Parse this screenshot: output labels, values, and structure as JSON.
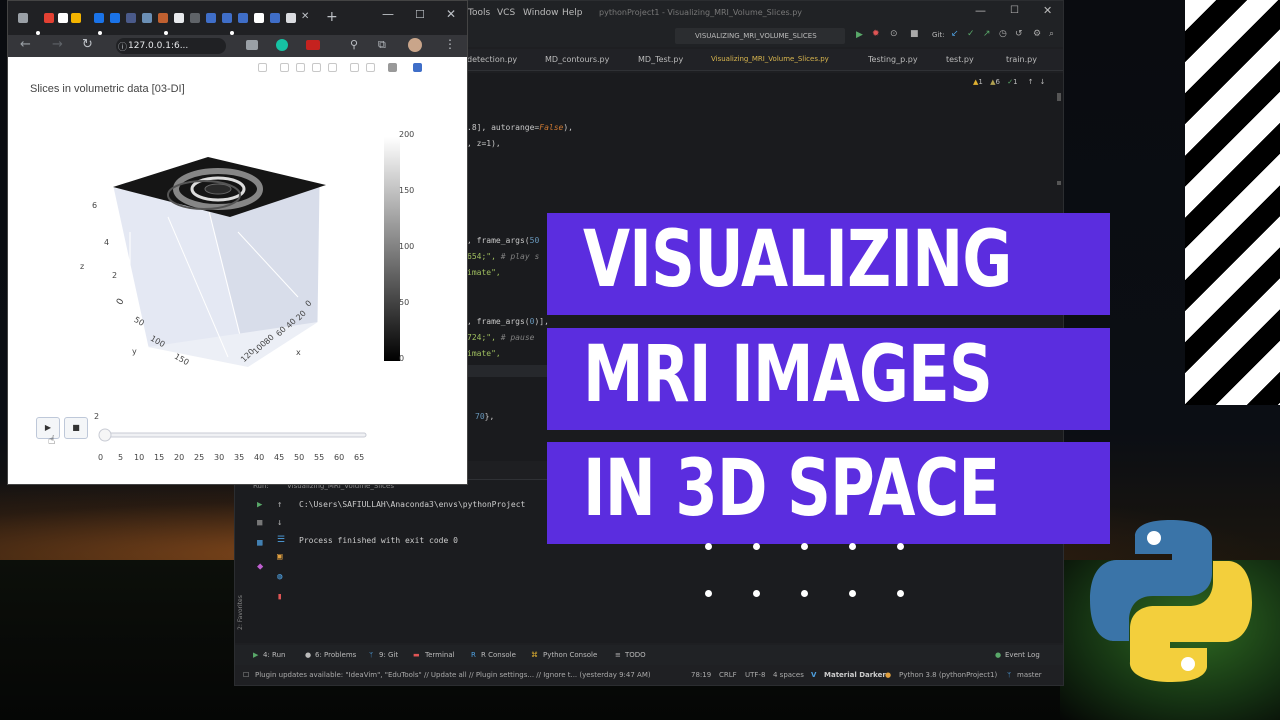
{
  "colors": {
    "banner": "#5b2ddf",
    "headline_text": "#ffffff",
    "ide_bg": "#1e1f22",
    "python_blue": "#3a74a8",
    "python_yellow": "#f3cf3c"
  },
  "headline": {
    "line1": "VISUALIZING",
    "line2": "MRI IMAGES",
    "line3": "IN 3D SPACE"
  },
  "ide": {
    "menu": {
      "tools": "Tools",
      "vcs": "VCS",
      "window": "Window",
      "help": "Help",
      "project_title": "pythonProject1 - Visualizing_MRI_Volume_Slices.py"
    },
    "run_config": "VISUALIZING_MRI_VOLUME_SLICES",
    "git_label": "Git:",
    "tabs": [
      "detection.py",
      "MD_contours.py",
      "MD_Test.py",
      "Visualizing_MRI_Volume_Slices.py",
      "Testing_p.py",
      "test.py",
      "train.py"
    ],
    "inspections": {
      "warnings": "1",
      "weak": "6",
      "typos": "1"
    },
    "code_lines": {
      "l1_a": ".8], autorange=",
      "l1_kw": "False",
      "l1_b": "),",
      "l2": ", z=1),",
      "l3_a": ", frame_args(",
      "l3_num": "50",
      "l4_a": "654;\",",
      "l4_cm": "# play s",
      "l5": "imate\",",
      "l6_a": ", frame_args(",
      "l6_num": "0",
      "l6_b": ")],",
      "l7_a": "724;\",",
      "l7_cm": "# pause",
      "l8": "imate\",",
      "l9_num": "70",
      "l9_b": "},"
    },
    "run_tab": "Run:",
    "run_tab_name": "Visualizing_MRI_Volume_Slices",
    "run_cmd": "C:\\Users\\SAFIULLAH\\Anaconda3\\envs\\pythonProject",
    "run_exit": "Process finished with exit code 0",
    "favorites": "2: Favorites",
    "bottom_tabs": {
      "run": "4: Run",
      "problems": "6: Problems",
      "git": "9: Git",
      "terminal": "Terminal",
      "rconsole": "R Console",
      "pyconsole": "Python Console",
      "todo": "TODO",
      "eventlog": "Event Log"
    },
    "status": {
      "message": "Plugin updates available: \"IdeaVim\", \"EduTools\" // Update all // Plugin settings... // Ignore t... (yesterday 9:47 AM)",
      "position": "78:19",
      "line_sep": "CRLF",
      "encoding": "UTF-8",
      "indent": "4 spaces",
      "theme": "Material Darker",
      "interpreter": "Python 3.8 (pythonProject1)",
      "branch": "master"
    }
  },
  "browser": {
    "url": "127.0.0.1:6...",
    "plot_title": "Slices in volumetric data [03-DI]",
    "colorbar_ticks": [
      "200",
      "150",
      "100",
      "50",
      "0"
    ],
    "z_ticks": [
      "6",
      "4",
      "2",
      "0"
    ],
    "z_label": "z",
    "y_ticks": [
      "0",
      "50",
      "100",
      "150"
    ],
    "y_label": "y",
    "x_ticks": [
      "0",
      "20",
      "40",
      "60",
      "80",
      "100",
      "120"
    ],
    "x_label": "x",
    "slider_current": "2",
    "slider_ticks": [
      "0",
      "5",
      "10",
      "15",
      "20",
      "25",
      "30",
      "35",
      "40",
      "45",
      "50",
      "55",
      "60",
      "65"
    ],
    "play_button": "▶",
    "stop_button": "■"
  }
}
